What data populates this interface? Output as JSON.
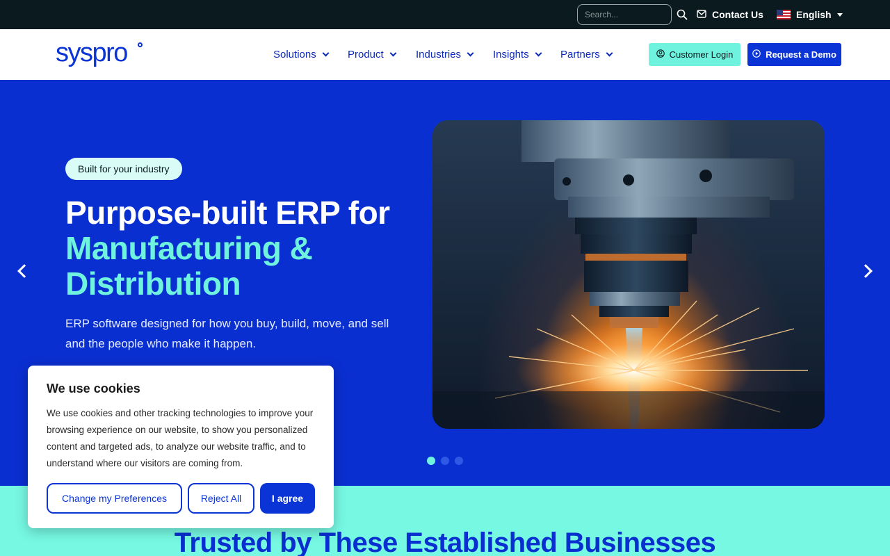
{
  "topbar": {
    "search_placeholder": "Search...",
    "contact_label": "Contact Us",
    "language_label": "English"
  },
  "nav": {
    "logo_text": "syspro",
    "items": [
      {
        "label": "Solutions"
      },
      {
        "label": "Product"
      },
      {
        "label": "Industries"
      },
      {
        "label": "Insights"
      },
      {
        "label": "Partners"
      }
    ],
    "login_label": "Customer Login",
    "demo_label": "Request a Demo"
  },
  "hero": {
    "badge": "Built for your industry",
    "title_line1": "Purpose-built ERP for",
    "title_accent": "Manufacturing & Distribution",
    "subtitle": "ERP software designed for how you buy, build, move, and sell and the people who make it happen.",
    "slides_total": 3,
    "slide_active": 1
  },
  "trusted": {
    "title": "Trusted by These Established Businesses"
  },
  "cookie": {
    "title": "We use cookies",
    "body": "We use cookies and other tracking technologies to improve your browsing experience on our website, to show you personalized content and targeted ads, to analyze our website traffic, and to understand where our visitors are coming from.",
    "preferences_label": "Change my Preferences",
    "reject_label": "Reject All",
    "agree_label": "I agree"
  },
  "colors": {
    "brand_blue": "#0a34d6",
    "hero_blue": "#0a2fd1",
    "accent_teal": "#6ff3df",
    "topbar_dark": "#0a1a1f"
  }
}
